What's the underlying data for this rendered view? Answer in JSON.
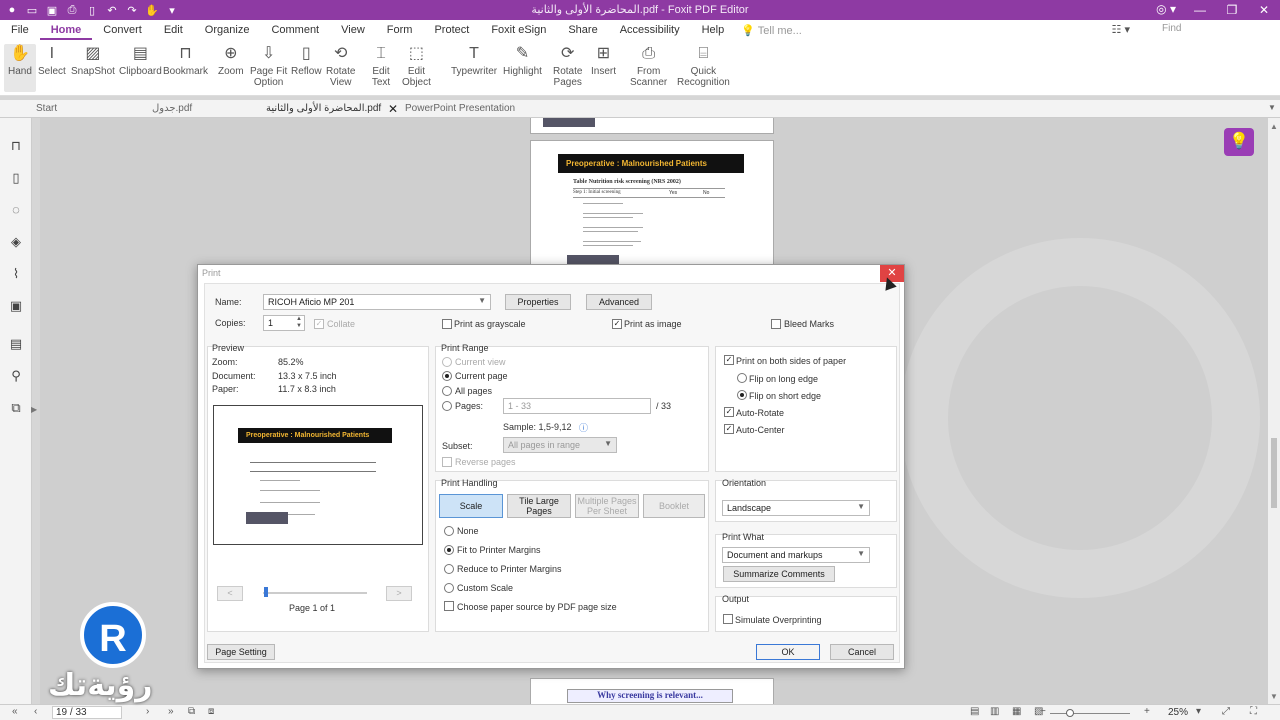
{
  "window": {
    "title": "المحاضرة الأولى  والثانية.pdf - Foxit PDF Editor"
  },
  "menubar": {
    "items": [
      "File",
      "Home",
      "Convert",
      "Edit",
      "Organize",
      "Comment",
      "View",
      "Form",
      "Protect",
      "Foxit eSign",
      "Share",
      "Accessibility",
      "Help"
    ],
    "active": "Home",
    "tell_me": "Tell me...",
    "find_placeholder": "Find"
  },
  "ribbon": {
    "hand": "Hand",
    "select": "Select",
    "snapshot": "SnapShot",
    "clipboard": "Clipboard",
    "bookmark": "Bookmark",
    "zoom": "Zoom",
    "page_fit_1": "Page Fit",
    "page_fit_2": "Option",
    "reflow": "Reflow",
    "rotate_view_1": "Rotate",
    "rotate_view_2": "View",
    "edit_text_1": "Edit",
    "edit_text_2": "Text",
    "edit_object_1": "Edit",
    "edit_object_2": "Object",
    "typewriter": "Typewriter",
    "highlight": "Highlight",
    "rotate_pages_1": "Rotate",
    "rotate_pages_2": "Pages",
    "insert": "Insert",
    "from_scanner_1": "From",
    "from_scanner_2": "Scanner",
    "quick_recognition_1": "Quick",
    "quick_recognition_2": "Recognition"
  },
  "tabs": {
    "start": "Start",
    "tab1": "جدول.pdf",
    "tab2": "المحاضرة الأولى  والثانية.pdf",
    "tab3": "PowerPoint Presentation"
  },
  "document": {
    "slide_title": "Preoperative : Malnourished Patients",
    "table_title": "Table Nutrition risk screening (NRS 2002)",
    "col_step": "Step 1: Initial screening",
    "col_yes": "Yes",
    "col_no": "No",
    "next_slide": "Why screening is relevant..."
  },
  "dialog": {
    "title": "Print",
    "name_label": "Name:",
    "printer": "RICOH Aficio MP 201",
    "properties": "Properties",
    "advanced": "Advanced",
    "copies_label": "Copies:",
    "copies_value": "1",
    "collate": "Collate",
    "print_grayscale": "Print as grayscale",
    "print_as_image": "Print as image",
    "bleed_marks": "Bleed Marks",
    "preview": {
      "heading": "Preview",
      "zoom_label": "Zoom:",
      "zoom_value": "85.2%",
      "document_label": "Document:",
      "document_value": "13.3 x 7.5 inch",
      "paper_label": "Paper:",
      "paper_value": "11.7 x 8.3 inch",
      "page_of": "Page 1 of 1"
    },
    "print_range": {
      "heading": "Print Range",
      "current_view": "Current view",
      "current_page": "Current page",
      "all_pages": "All pages",
      "pages": "Pages:",
      "pages_placeholder": "1 - 33",
      "total": "/ 33",
      "sample": "Sample: 1,5-9,12",
      "subset_label": "Subset:",
      "subset_value": "All pages in range",
      "reverse": "Reverse pages"
    },
    "print_handling": {
      "heading": "Print Handling",
      "scale": "Scale",
      "tile_1": "Tile Large",
      "tile_2": "Pages",
      "multiple_1": "Multiple Pages",
      "multiple_2": "Per Sheet",
      "booklet": "Booklet",
      "none": "None",
      "fit": "Fit to Printer Margins",
      "reduce": "Reduce to Printer Margins",
      "custom": "Custom Scale",
      "choose_source": "Choose paper source by PDF page size"
    },
    "duplex": {
      "both_sides": "Print on both sides of paper",
      "long_edge": "Flip on long edge",
      "short_edge": "Flip on short edge",
      "auto_rotate": "Auto-Rotate",
      "auto_center": "Auto-Center"
    },
    "orientation": {
      "heading": "Orientation",
      "value": "Landscape"
    },
    "print_what": {
      "heading": "Print What",
      "value": "Document and markups",
      "summarize": "Summarize Comments"
    },
    "output": {
      "heading": "Output",
      "simulate": "Simulate Overprinting"
    },
    "page_setting": "Page Setting",
    "ok": "OK",
    "cancel": "Cancel"
  },
  "statusbar": {
    "page": "19 / 33",
    "zoom": "25%"
  },
  "logo": {
    "letter": "R",
    "text": "رؤيةتك"
  }
}
